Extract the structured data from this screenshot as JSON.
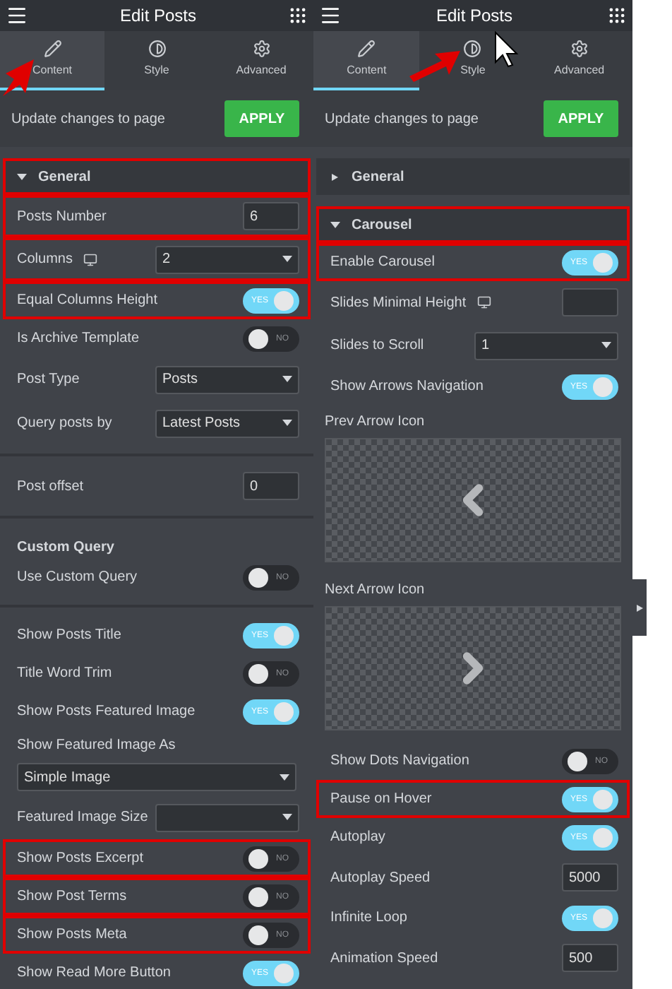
{
  "panels": [
    {
      "header": {
        "title": "Edit Posts"
      },
      "tabs": [
        {
          "label": "Content",
          "selected": true
        },
        {
          "label": "Style",
          "selected": false
        },
        {
          "label": "Advanced",
          "selected": false
        }
      ],
      "apply_bar": {
        "text": "Update changes to page",
        "button": "APPLY"
      },
      "rows": [
        {
          "kind": "section",
          "label": "General",
          "expanded": true,
          "highlighted": true
        },
        {
          "kind": "number",
          "label": "Posts Number",
          "value": "6",
          "highlighted": true
        },
        {
          "kind": "select",
          "label": "Columns",
          "responsive": true,
          "value": "2",
          "highlighted": true
        },
        {
          "kind": "toggle",
          "label": "Equal Columns Height",
          "on": true,
          "toggle_text": "YES",
          "highlighted": true
        },
        {
          "kind": "toggle",
          "label": "Is Archive Template",
          "on": false,
          "toggle_text": "NO",
          "highlighted": false
        },
        {
          "kind": "select",
          "label": "Post Type",
          "value": "Posts",
          "highlighted": false
        },
        {
          "kind": "select",
          "label": "Query posts by",
          "value": "Latest Posts",
          "highlighted": false
        },
        {
          "kind": "divider"
        },
        {
          "kind": "number",
          "label": "Post offset",
          "value": "0",
          "highlighted": false
        },
        {
          "kind": "divider"
        },
        {
          "kind": "heading",
          "label": "Custom Query"
        },
        {
          "kind": "toggle",
          "label": "Use Custom Query",
          "on": false,
          "toggle_text": "NO",
          "highlighted": false
        },
        {
          "kind": "divider"
        },
        {
          "kind": "toggle",
          "label": "Show Posts Title",
          "on": true,
          "toggle_text": "YES",
          "highlighted": false
        },
        {
          "kind": "toggle",
          "label": "Title Word Trim",
          "on": false,
          "toggle_text": "NO",
          "highlighted": false
        },
        {
          "kind": "toggle",
          "label": "Show Posts Featured Image",
          "on": true,
          "toggle_text": "YES",
          "highlighted": false
        },
        {
          "kind": "label",
          "label": "Show Featured Image As"
        },
        {
          "kind": "wide_select",
          "value": "Simple Image"
        },
        {
          "kind": "select",
          "label": "Featured Image Size",
          "highlighted": false
        },
        {
          "kind": "toggle",
          "label": "Show Posts Excerpt",
          "on": false,
          "toggle_text": "NO",
          "highlighted": true
        },
        {
          "kind": "toggle",
          "label": "Show Post Terms",
          "on": false,
          "toggle_text": "NO",
          "highlighted": true
        },
        {
          "kind": "toggle",
          "label": "Show Posts Meta",
          "on": false,
          "toggle_text": "NO",
          "highlighted": true
        },
        {
          "kind": "toggle",
          "label": "Show Read More Button",
          "on": true,
          "toggle_text": "YES",
          "highlighted": false
        }
      ]
    },
    {
      "header": {
        "title": "Edit Posts"
      },
      "tabs": [
        {
          "label": "Content",
          "selected": true
        },
        {
          "label": "Style",
          "selected": false
        },
        {
          "label": "Advanced",
          "selected": false
        }
      ],
      "apply_bar": {
        "text": "Update changes to page",
        "button": "APPLY"
      },
      "rows": [
        {
          "kind": "section",
          "label": "General",
          "expanded": false,
          "highlighted": false
        },
        {
          "kind": "section",
          "label": "Carousel",
          "expanded": true,
          "highlighted": true
        },
        {
          "kind": "toggle",
          "label": "Enable Carousel",
          "on": true,
          "toggle_text": "YES",
          "highlighted": true
        },
        {
          "kind": "number",
          "label": "Slides Minimal Height",
          "responsive": true,
          "highlighted": false
        },
        {
          "kind": "select",
          "label": "Slides to Scroll",
          "value": "1",
          "highlighted": false
        },
        {
          "kind": "toggle",
          "label": "Show Arrows Navigation",
          "on": true,
          "toggle_text": "YES",
          "highlighted": false
        },
        {
          "kind": "icon_picker",
          "label": "Prev Arrow Icon"
        },
        {
          "kind": "icon_picker",
          "label": "Next Arrow Icon"
        },
        {
          "kind": "toggle",
          "label": "Show Dots Navigation",
          "on": false,
          "toggle_text": "NO",
          "highlighted": false
        },
        {
          "kind": "toggle",
          "label": "Pause on Hover",
          "on": true,
          "toggle_text": "YES",
          "highlighted": true
        },
        {
          "kind": "toggle",
          "label": "Autoplay",
          "on": true,
          "toggle_text": "YES",
          "highlighted": false
        },
        {
          "kind": "number",
          "label": "Autoplay Speed",
          "value": "5000",
          "highlighted": false
        },
        {
          "kind": "toggle",
          "label": "Infinite Loop",
          "on": true,
          "toggle_text": "YES",
          "highlighted": false
        },
        {
          "kind": "number",
          "label": "Animation Speed",
          "value": "500",
          "highlighted": false
        }
      ]
    }
  ]
}
